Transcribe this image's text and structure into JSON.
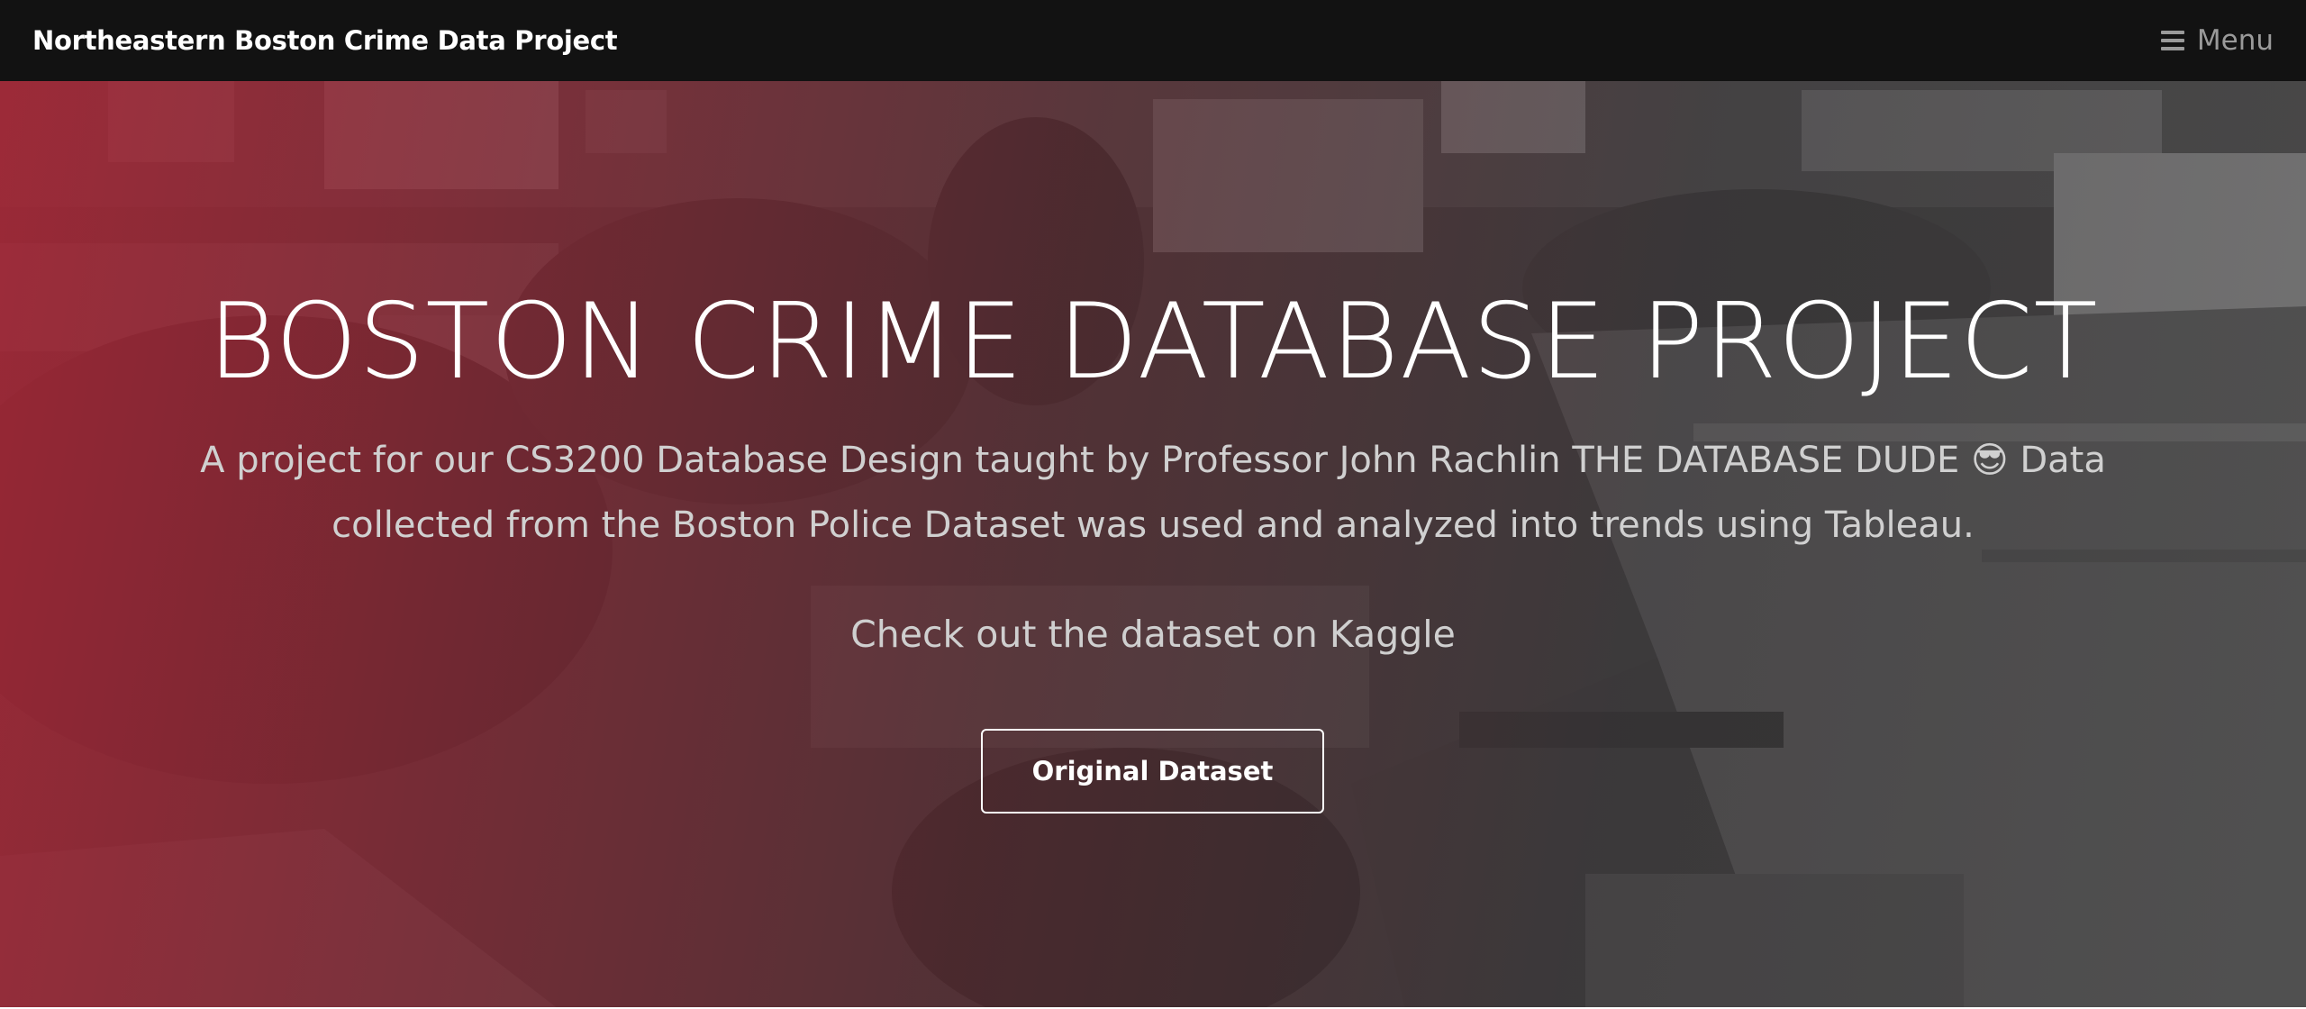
{
  "navbar": {
    "brand": "Northeastern Boston Crime Data Project",
    "menu_icon": "hamburger-menu-icon",
    "menu_label": "Menu"
  },
  "hero": {
    "background": "aerial-city-photo",
    "title": "BOSTON CRIME DATABASE PROJECT",
    "description": "A project for our CS3200 Database Design taught by Professor John Rachlin THE DATABASE DUDE 😎 Data collected from the Boston Police Dataset was used and analyzed into trends using Tableau.",
    "subheading": "Check out the dataset on Kaggle",
    "button_label": "Original Dataset"
  },
  "colors": {
    "navbar_bg": "#121212",
    "gradient_red": "#a82636",
    "text_white": "#ffffff",
    "muted_text": "#d0d0d0"
  }
}
